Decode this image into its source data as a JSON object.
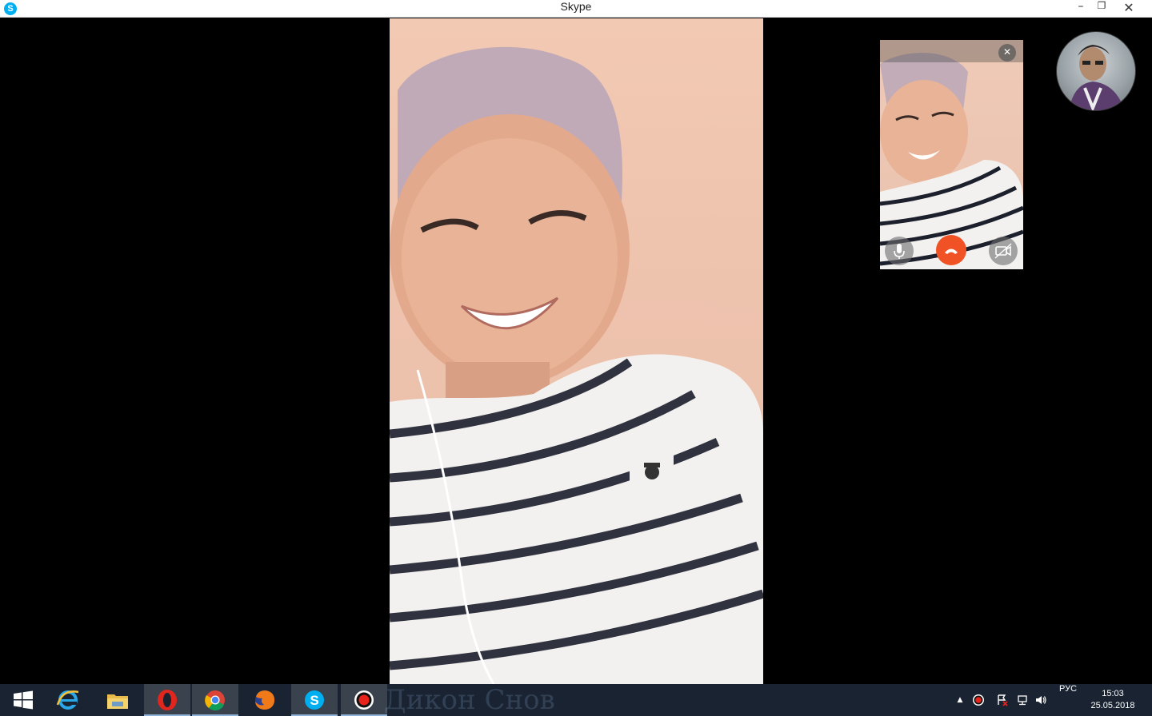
{
  "window": {
    "title": "Skype",
    "app_icon_letter": "S",
    "minimize_glyph": "–",
    "maximize_glyph": "❐",
    "close_glyph": "✕"
  },
  "call": {
    "self_view_close_glyph": "✕",
    "controls": [
      "microphone-icon",
      "hang-up-icon",
      "video-camera-icon"
    ],
    "hangup_color": "#f05125"
  },
  "taskbar": {
    "apps": [
      "windows-start-icon",
      "internet-explorer-icon",
      "file-explorer-icon",
      "opera-icon",
      "chrome-icon",
      "firefox-icon",
      "skype-icon",
      "recorder-icon"
    ],
    "background_text": "Дикон Снов",
    "tray": {
      "show_hidden_glyph": "▲",
      "language": "РУС",
      "time": "15:03",
      "date": "25.05.2018"
    }
  }
}
